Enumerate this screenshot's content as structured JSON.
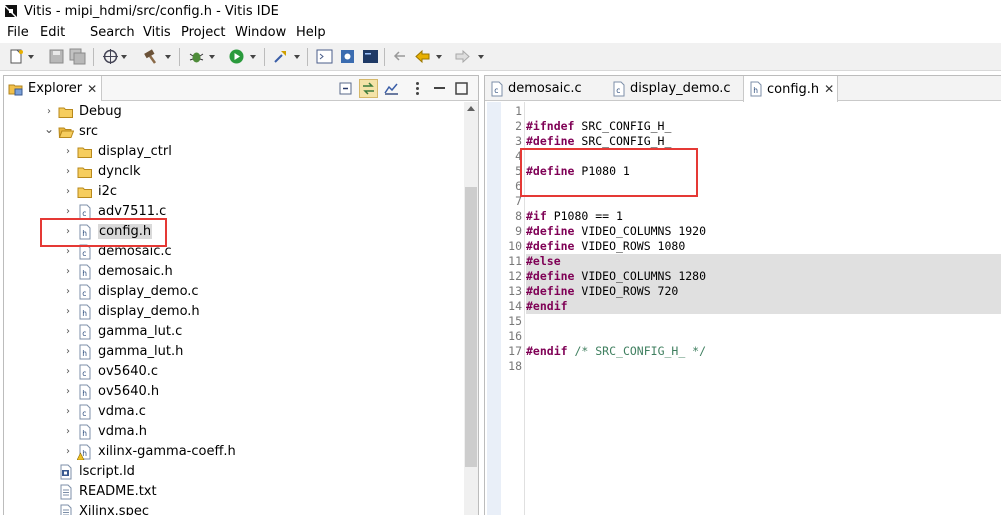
{
  "window": {
    "title": "Vitis - mipi_hdmi/src/config.h - Vitis IDE"
  },
  "menu": [
    "File",
    "Edit",
    "Search",
    "Vitis",
    "Project",
    "Window",
    "Help"
  ],
  "explorer": {
    "tab_label": "Explorer",
    "close_glyph": "✕",
    "tree": [
      {
        "label": "Debug",
        "type": "folder",
        "level": 1,
        "expanded": false
      },
      {
        "label": "src",
        "type": "folder-open",
        "level": 1,
        "expanded": true
      },
      {
        "label": "display_ctrl",
        "type": "folder",
        "level": 2,
        "expanded": false
      },
      {
        "label": "dynclk",
        "type": "folder",
        "level": 2,
        "expanded": false
      },
      {
        "label": "i2c",
        "type": "folder",
        "level": 2,
        "expanded": false
      },
      {
        "label": "adv7511.c",
        "type": "c-file",
        "level": 2,
        "expanded": false
      },
      {
        "label": "config.h",
        "type": "h-file",
        "level": 2,
        "expanded": false,
        "selected": true
      },
      {
        "label": "demosaic.c",
        "type": "c-file",
        "level": 2,
        "expanded": false
      },
      {
        "label": "demosaic.h",
        "type": "h-file",
        "level": 2,
        "expanded": false
      },
      {
        "label": "display_demo.c",
        "type": "c-file",
        "level": 2,
        "expanded": false
      },
      {
        "label": "display_demo.h",
        "type": "h-file",
        "level": 2,
        "expanded": false
      },
      {
        "label": "gamma_lut.c",
        "type": "c-file",
        "level": 2,
        "expanded": false
      },
      {
        "label": "gamma_lut.h",
        "type": "h-file",
        "level": 2,
        "expanded": false
      },
      {
        "label": "ov5640.c",
        "type": "c-file",
        "level": 2,
        "expanded": false
      },
      {
        "label": "ov5640.h",
        "type": "h-file",
        "level": 2,
        "expanded": false
      },
      {
        "label": "vdma.c",
        "type": "c-file",
        "level": 2,
        "expanded": false
      },
      {
        "label": "vdma.h",
        "type": "h-file",
        "level": 2,
        "expanded": false
      },
      {
        "label": "xilinx-gamma-coeff.h",
        "type": "h-file-warn",
        "level": 2,
        "expanded": false
      },
      {
        "label": "lscript.ld",
        "type": "ld-file",
        "level": 1,
        "expanded": null
      },
      {
        "label": "README.txt",
        "type": "txt-file",
        "level": 1,
        "expanded": null
      },
      {
        "label": "Xilinx.spec",
        "type": "txt-file",
        "level": 1,
        "expanded": null
      }
    ]
  },
  "editor": {
    "tabs": [
      {
        "label": "demosaic.c",
        "icon": "c-file",
        "active": false
      },
      {
        "label": "display_demo.c",
        "icon": "c-file",
        "active": false
      },
      {
        "label": "config.h",
        "icon": "h-file",
        "active": true
      }
    ],
    "close_glyph": "✕",
    "lines": [
      {
        "num": "1",
        "parts": [],
        "hl": false
      },
      {
        "num": "2",
        "parts": [
          {
            "t": "kw",
            "v": "#ifndef"
          },
          {
            "t": "tx",
            "v": " SRC_CONFIG_H_"
          }
        ],
        "hl": false
      },
      {
        "num": "3",
        "parts": [
          {
            "t": "kw",
            "v": "#define"
          },
          {
            "t": "tx",
            "v": " SRC_CONFIG_H_"
          }
        ],
        "hl": false
      },
      {
        "num": "4",
        "parts": [],
        "hl": false
      },
      {
        "num": "5",
        "parts": [
          {
            "t": "kw",
            "v": "#define"
          },
          {
            "t": "tx",
            "v": " P1080 1"
          }
        ],
        "hl": false
      },
      {
        "num": "6",
        "parts": [],
        "hl": false
      },
      {
        "num": "7",
        "parts": [],
        "hl": false
      },
      {
        "num": "8",
        "parts": [
          {
            "t": "kw",
            "v": "#if"
          },
          {
            "t": "tx",
            "v": " P1080 == 1"
          }
        ],
        "hl": false
      },
      {
        "num": "9",
        "parts": [
          {
            "t": "kw",
            "v": "#define"
          },
          {
            "t": "tx",
            "v": " VIDEO_COLUMNS 1920"
          }
        ],
        "hl": false
      },
      {
        "num": "10",
        "parts": [
          {
            "t": "kw",
            "v": "#define"
          },
          {
            "t": "tx",
            "v": " VIDEO_ROWS 1080"
          }
        ],
        "hl": false
      },
      {
        "num": "11",
        "parts": [
          {
            "t": "kw",
            "v": "#else"
          }
        ],
        "hl": true
      },
      {
        "num": "12",
        "parts": [
          {
            "t": "kw",
            "v": "#define"
          },
          {
            "t": "tx",
            "v": " VIDEO_COLUMNS 1280"
          }
        ],
        "hl": true
      },
      {
        "num": "13",
        "parts": [
          {
            "t": "kw",
            "v": "#define"
          },
          {
            "t": "tx",
            "v": " VIDEO_ROWS 720"
          }
        ],
        "hl": true
      },
      {
        "num": "14",
        "parts": [
          {
            "t": "kw",
            "v": "#endif"
          }
        ],
        "hl": true
      },
      {
        "num": "15",
        "parts": [],
        "hl": false
      },
      {
        "num": "16",
        "parts": [],
        "hl": false
      },
      {
        "num": "17",
        "parts": [
          {
            "t": "kw",
            "v": "#endif"
          },
          {
            "t": "tx",
            "v": " "
          },
          {
            "t": "cm",
            "v": "/* SRC_CONFIG_H_ */"
          }
        ],
        "hl": false
      },
      {
        "num": "18",
        "parts": [],
        "hl": false
      }
    ]
  },
  "colors": {
    "keyword": "#7f0055",
    "comment": "#3f7f5f",
    "annotation_box": "#e53935",
    "inactive_code_bg": "#e0e0e0"
  }
}
